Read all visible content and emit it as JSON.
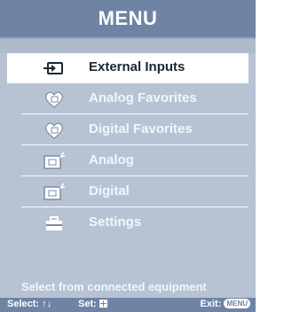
{
  "title": "MENU",
  "menu": {
    "items": [
      {
        "label": "External Inputs",
        "icon": "input-icon",
        "selected": true
      },
      {
        "label": "Analog Favorites",
        "icon": "heart-analog-icon",
        "selected": false
      },
      {
        "label": "Digital Favorites",
        "icon": "heart-digital-icon",
        "selected": false
      },
      {
        "label": "Analog",
        "icon": "analog-tv-icon",
        "selected": false
      },
      {
        "label": "Digital",
        "icon": "digital-tv-icon",
        "selected": false
      },
      {
        "label": "Settings",
        "icon": "toolbox-icon",
        "selected": false
      }
    ]
  },
  "description": "Select from connected equipment",
  "bottom": {
    "select_label": "Select:",
    "select_arrows": "↑↓",
    "set_label": "Set:",
    "exit_label": "Exit:",
    "exit_button": "MENU"
  },
  "colors": {
    "background": "#b7c3d3",
    "header": "#6f83a4",
    "selected_row": "#ffffff"
  }
}
